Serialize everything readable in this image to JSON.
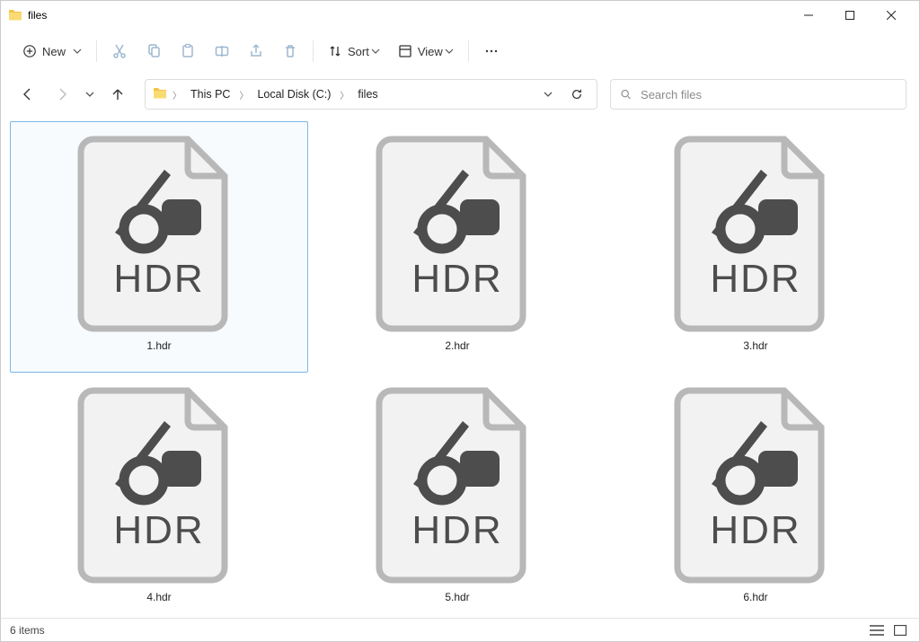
{
  "window": {
    "title": "files"
  },
  "toolbar": {
    "new_label": "New",
    "sort_label": "Sort",
    "view_label": "View"
  },
  "breadcrumbs": {
    "items": [
      {
        "label": "This PC"
      },
      {
        "label": "Local Disk (C:)"
      },
      {
        "label": "files"
      }
    ]
  },
  "search": {
    "placeholder": "Search files"
  },
  "files": {
    "items": [
      {
        "name": "1.hdr",
        "type_label": "HDR",
        "selected": true
      },
      {
        "name": "2.hdr",
        "type_label": "HDR",
        "selected": false
      },
      {
        "name": "3.hdr",
        "type_label": "HDR",
        "selected": false
      },
      {
        "name": "4.hdr",
        "type_label": "HDR",
        "selected": false
      },
      {
        "name": "5.hdr",
        "type_label": "HDR",
        "selected": false
      },
      {
        "name": "6.hdr",
        "type_label": "HDR",
        "selected": false
      }
    ]
  },
  "status": {
    "count_text": "6 items"
  }
}
